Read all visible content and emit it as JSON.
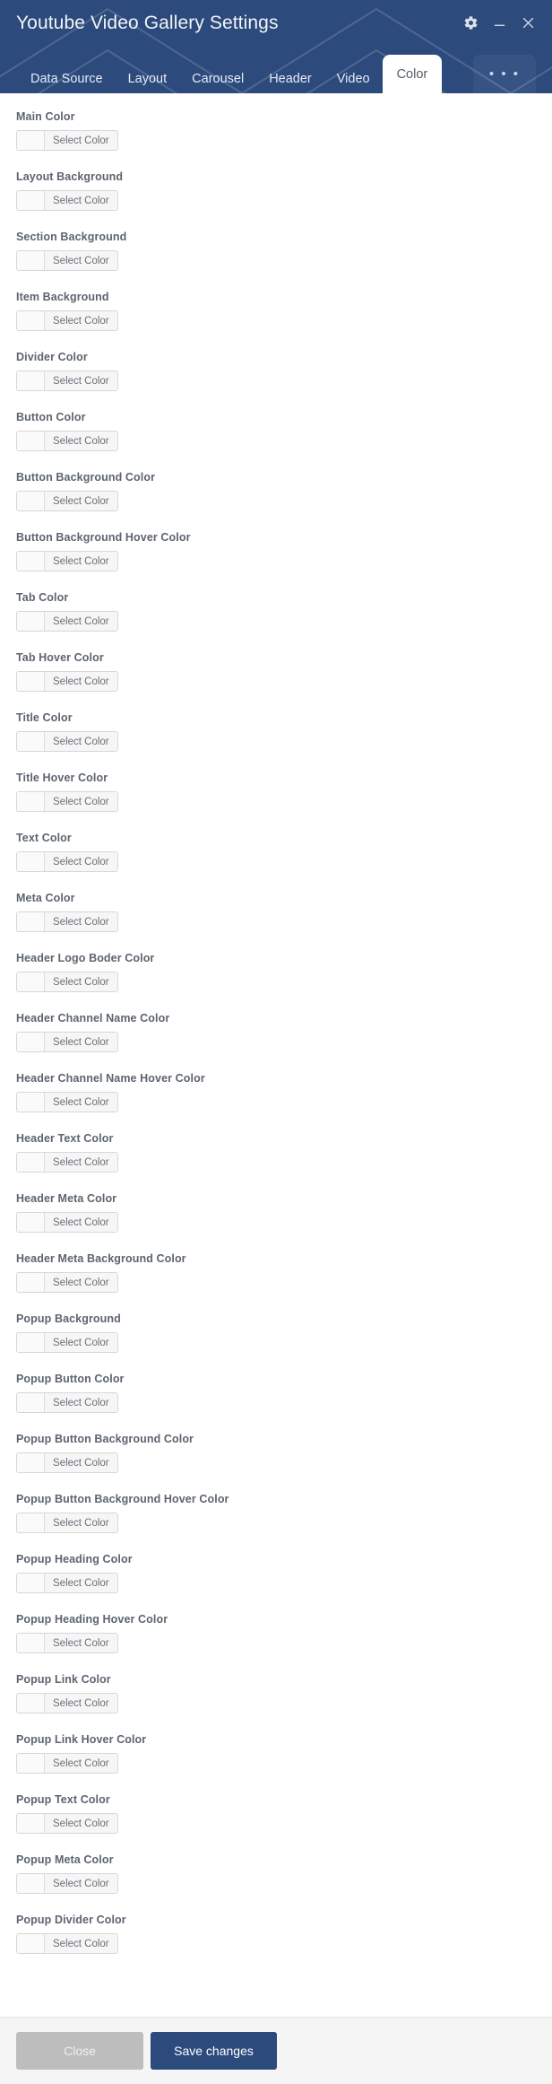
{
  "window": {
    "title": "Youtube Video Gallery Settings",
    "controls": [
      {
        "name": "settings-gear",
        "icon": "gear-icon"
      },
      {
        "name": "minimize",
        "icon": "minimize-icon"
      },
      {
        "name": "close",
        "icon": "close-icon"
      }
    ]
  },
  "tabs": {
    "items": [
      {
        "label": "Data Source",
        "active": false
      },
      {
        "label": "Layout",
        "active": false
      },
      {
        "label": "Carousel",
        "active": false
      },
      {
        "label": "Header",
        "active": false
      },
      {
        "label": "Video",
        "active": false
      },
      {
        "label": "Color",
        "active": true
      }
    ],
    "overflow_label": "• • •"
  },
  "colors": {
    "header_background": "#2c4a7c",
    "active_tab_background": "#ffffff",
    "save_button": "#2c4a7c",
    "close_button": "#bdbdbd",
    "footer_background": "#f5f5f5",
    "label_text": "#5d6470"
  },
  "form": {
    "select_color_label": "Select Color",
    "fields": [
      {
        "label": "Main Color",
        "swatch": ""
      },
      {
        "label": "Layout Background",
        "swatch": ""
      },
      {
        "label": "Section Background",
        "swatch": ""
      },
      {
        "label": "Item Background",
        "swatch": ""
      },
      {
        "label": "Divider Color",
        "swatch": ""
      },
      {
        "label": "Button Color",
        "swatch": ""
      },
      {
        "label": "Button Background Color",
        "swatch": ""
      },
      {
        "label": "Button Background Hover Color",
        "swatch": ""
      },
      {
        "label": "Tab Color",
        "swatch": ""
      },
      {
        "label": "Tab Hover Color",
        "swatch": ""
      },
      {
        "label": "Title Color",
        "swatch": ""
      },
      {
        "label": "Title Hover Color",
        "swatch": ""
      },
      {
        "label": "Text Color",
        "swatch": ""
      },
      {
        "label": "Meta Color",
        "swatch": ""
      },
      {
        "label": "Header Logo Boder Color",
        "swatch": ""
      },
      {
        "label": "Header Channel Name Color",
        "swatch": ""
      },
      {
        "label": "Header Channel Name Hover Color",
        "swatch": ""
      },
      {
        "label": "Header Text Color",
        "swatch": ""
      },
      {
        "label": "Header Meta Color",
        "swatch": ""
      },
      {
        "label": "Header Meta Background Color",
        "swatch": ""
      },
      {
        "label": "Popup Background",
        "swatch": ""
      },
      {
        "label": "Popup Button Color",
        "swatch": ""
      },
      {
        "label": "Popup Button Background Color",
        "swatch": ""
      },
      {
        "label": "Popup Button Background Hover Color",
        "swatch": ""
      },
      {
        "label": "Popup Heading Color",
        "swatch": ""
      },
      {
        "label": "Popup Heading Hover Color",
        "swatch": ""
      },
      {
        "label": "Popup Link Color",
        "swatch": ""
      },
      {
        "label": "Popup Link Hover Color",
        "swatch": ""
      },
      {
        "label": "Popup Text Color",
        "swatch": ""
      },
      {
        "label": "Popup Meta Color",
        "swatch": ""
      },
      {
        "label": "Popup Divider Color",
        "swatch": ""
      }
    ]
  },
  "footer": {
    "close_label": "Close",
    "save_label": "Save changes"
  }
}
